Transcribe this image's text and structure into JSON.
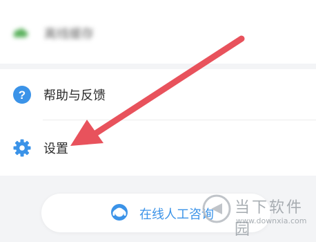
{
  "menu": {
    "offline_cache": {
      "label": "离线缓存",
      "icon": "cloud-icon",
      "color": "#5ab15c"
    },
    "help_feedback": {
      "label": "帮助与反馈",
      "icon": "question-circle-icon",
      "color": "#3b93e8"
    },
    "settings": {
      "label": "设置",
      "icon": "gear-icon",
      "color": "#3b93e8"
    }
  },
  "consult_button": {
    "label": "在线人工咨询",
    "icon": "headset-icon",
    "color": "#3b93e8"
  },
  "annotation": {
    "arrow_color": "#e8525c"
  },
  "watermark": {
    "title": "当下软件园",
    "url": "www.downxia.com"
  }
}
